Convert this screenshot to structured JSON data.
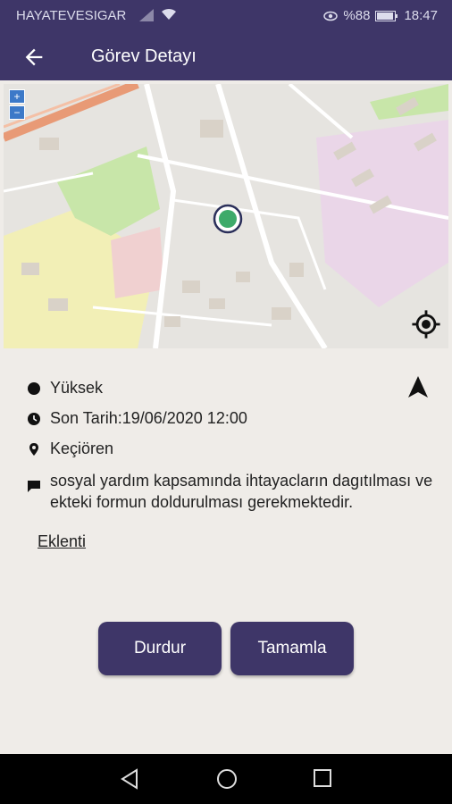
{
  "status": {
    "carrier": "HAYATEVESIGAR",
    "battery": "%88",
    "time": "18:47"
  },
  "header": {
    "title": "Görev Detayı"
  },
  "map": {
    "zoom_in": "+",
    "zoom_out": "−"
  },
  "details": {
    "priority": "Yüksek",
    "deadline": "Son Tarih:19/06/2020 12:00",
    "location": "Keçiören",
    "description": "sosyal yardım kapsamında ihtayacların dagıtılması ve ekteki formun doldurulması gerekmektedir.",
    "attachment": "Eklenti"
  },
  "actions": {
    "stop": "Durdur",
    "complete": "Tamamla"
  },
  "colors": {
    "primary": "#3e3668",
    "background": "#efece8",
    "marker": "#3daa6a"
  }
}
